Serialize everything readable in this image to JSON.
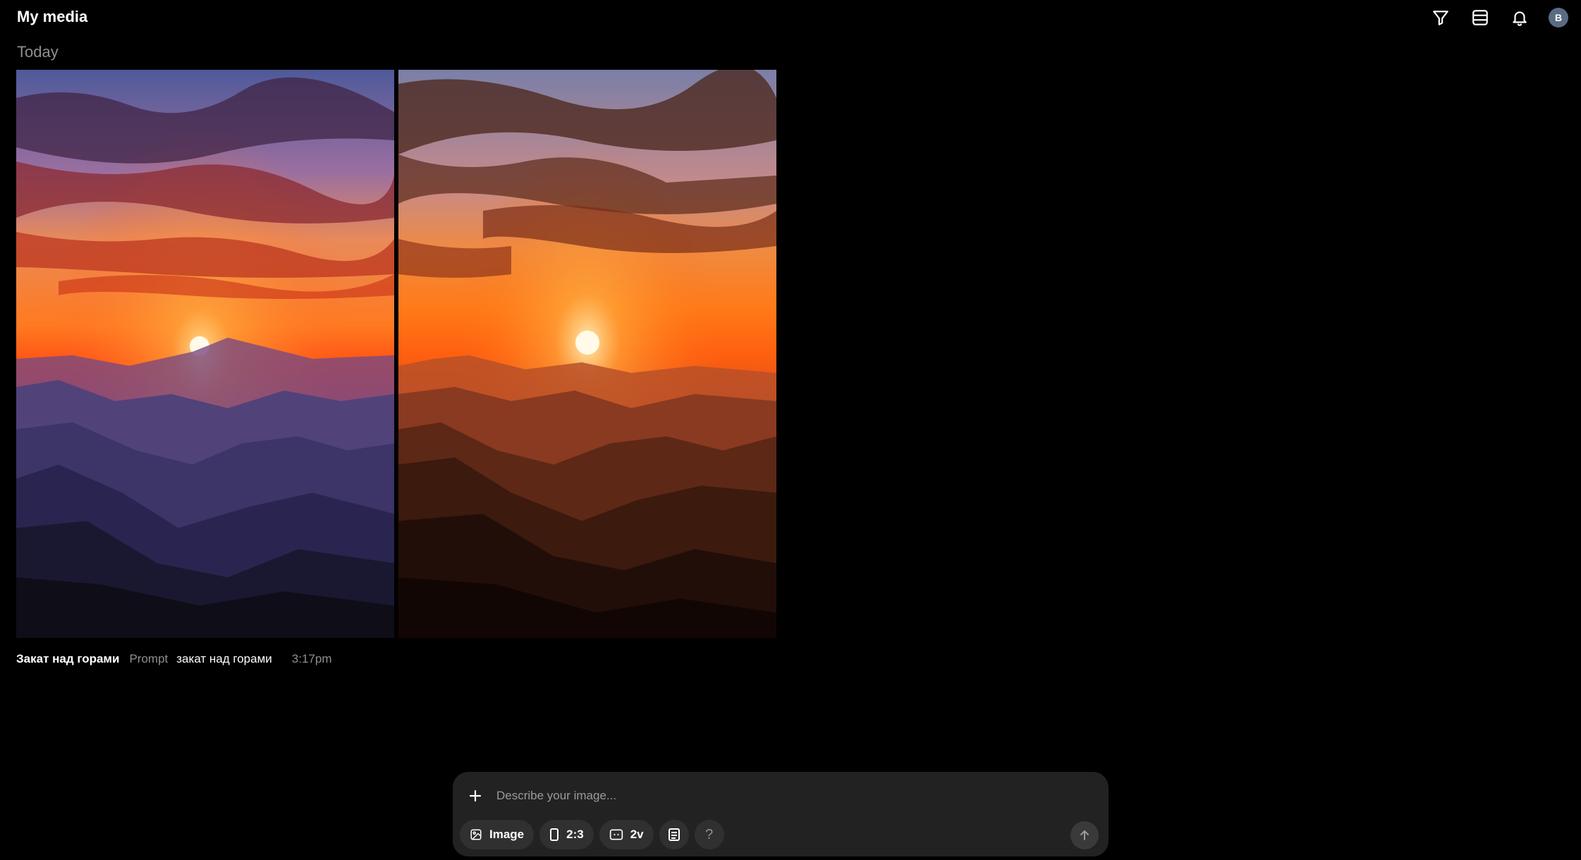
{
  "header": {
    "title": "My media",
    "section": "Today",
    "actions": [
      {
        "name": "filter-icon"
      },
      {
        "name": "list-view-icon"
      },
      {
        "name": "bell-icon"
      }
    ],
    "avatar_initial": "B"
  },
  "media": {
    "items": [
      {
        "alt": "Sunset over mountains (purple)"
      },
      {
        "alt": "Sunset over mountains (orange)"
      }
    ],
    "title": "Закат над горами",
    "prompt_label": "Prompt",
    "prompt_text": "закат над горами",
    "time": "3:17pm"
  },
  "composer": {
    "placeholder": "Describe your image...",
    "tools": {
      "mode_label": "Image",
      "aspect_label": "2:3",
      "variations_label": "2v",
      "help_label": "?"
    }
  },
  "colors": {
    "background": "#000000",
    "composer_bg": "#222223",
    "chip_bg": "#303031",
    "muted_text": "#8f8f8f",
    "avatar_bg": "#5a6b84"
  }
}
